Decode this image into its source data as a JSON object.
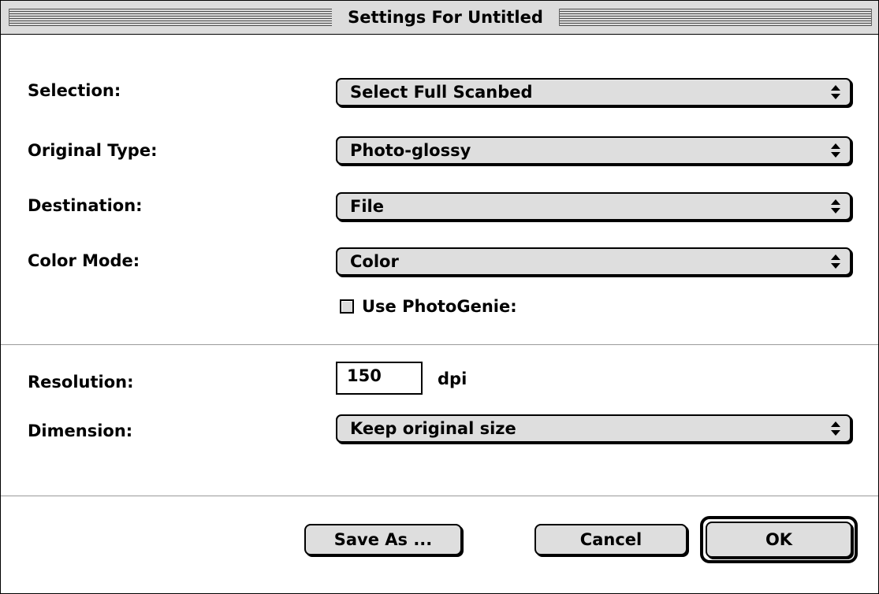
{
  "window": {
    "title": "Settings For Untitled"
  },
  "settings": {
    "selection": {
      "label": "Selection:",
      "value": "Select Full Scanbed"
    },
    "original_type": {
      "label": "Original Type:",
      "value": "Photo-glossy"
    },
    "destination": {
      "label": "Destination:",
      "value": "File"
    },
    "color_mode": {
      "label": "Color Mode:",
      "value": "Color"
    },
    "photogenie": {
      "label": "Use PhotoGenie:",
      "checked": false
    },
    "resolution": {
      "label": "Resolution:",
      "value": "150",
      "unit": "dpi"
    },
    "dimension": {
      "label": "Dimension:",
      "value": "Keep original size"
    }
  },
  "buttons": {
    "save_as": "Save As ...",
    "cancel": "Cancel",
    "ok": "OK"
  },
  "icons": {
    "popup_arrows": "updown-arrows-icon"
  }
}
